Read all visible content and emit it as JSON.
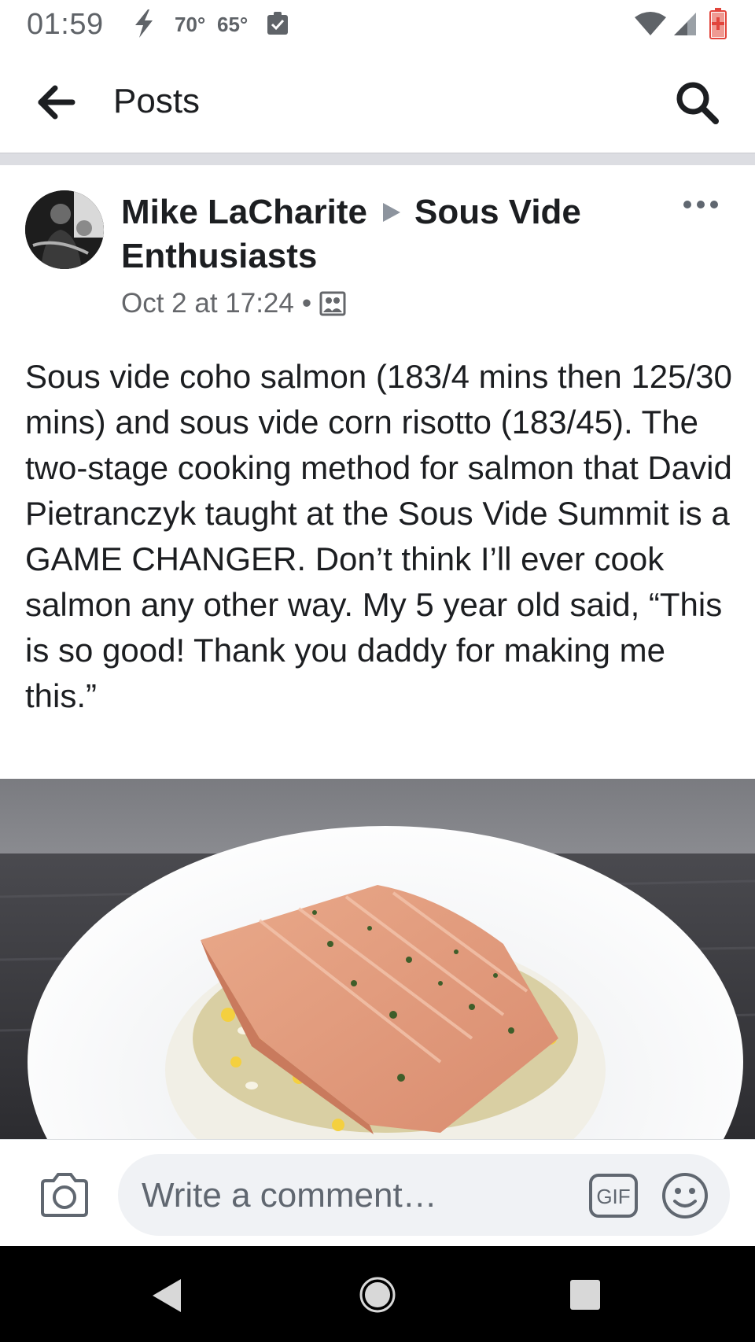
{
  "status_bar": {
    "time": "01:59",
    "temp_high": "70°",
    "temp_low": "65°",
    "icons": [
      "charging-bolt-icon",
      "clipboard-check-icon",
      "wifi-icon",
      "cell-signal-icon",
      "battery-low-icon"
    ],
    "battery_color": "#e2453c"
  },
  "app_bar": {
    "title": "Posts",
    "back_icon": "arrow-left-icon",
    "search_icon": "search-icon"
  },
  "post": {
    "author": "Mike LaCharite",
    "group": "Sous Vide Enthusiasts",
    "timestamp": "Oct 2 at 17:24",
    "separator": "•",
    "audience_icon": "group-icon",
    "more_icon": "more-dots-icon",
    "text": "Sous vide coho salmon (183/4 mins then 125/30 mins) and sous vide corn risotto (183/45). The two-stage cooking method for salmon that David Pietranczyk taught at the Sous Vide Summit is a GAME CHANGER. Don’t think I’ll ever cook salmon any other way. My 5 year old said, “This is so good! Thank you daddy for making me this.”"
  },
  "comment_bar": {
    "placeholder": "Write a comment…",
    "gif_label": "GIF",
    "camera_icon": "camera-icon",
    "emoji_icon": "smiley-icon"
  },
  "nav_bar": {
    "icons": [
      "nav-back-icon",
      "nav-home-icon",
      "nav-recents-icon"
    ]
  },
  "colors": {
    "text_primary": "#1c1e21",
    "text_secondary": "#65676b",
    "divider": "#dcdde2",
    "input_bg": "#f0f2f5"
  }
}
